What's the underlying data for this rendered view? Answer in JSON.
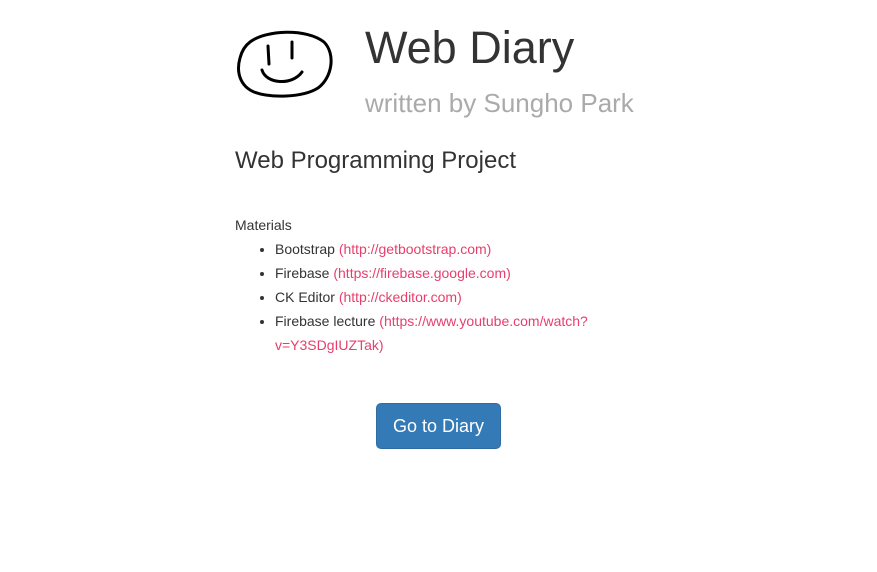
{
  "header": {
    "title": "Web Diary",
    "subtitle": "written by Sungho Park",
    "logo_icon": "smiley-face-icon"
  },
  "project": {
    "title": "Web Programming Project"
  },
  "materials": {
    "label": "Materials",
    "items": [
      {
        "name": "Bootstrap ",
        "link": "(http://getbootstrap.com)"
      },
      {
        "name": "Firebase ",
        "link": "(https://firebase.google.com)"
      },
      {
        "name": "CK Editor ",
        "link": "(http://ckeditor.com)"
      },
      {
        "name": "Firebase lecture ",
        "link": "(https://www.youtube.com/watch?v=Y3SDgIUZTak)"
      }
    ]
  },
  "actions": {
    "go_label": "Go to Diary",
    "button_color": "#337ab7"
  },
  "colors": {
    "link": "#e83e6c",
    "subtitle": "#aaaaaa",
    "text": "#333333"
  }
}
